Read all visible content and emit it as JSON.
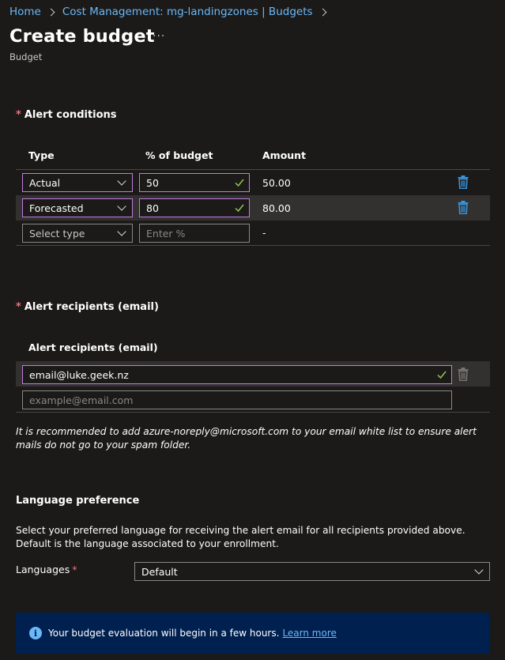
{
  "breadcrumb": {
    "items": [
      "Home",
      "Cost Management: mg-landingzones | Budgets"
    ]
  },
  "header": {
    "title": "Create budget",
    "more": "···",
    "subtitle": "Budget"
  },
  "alert_conditions": {
    "heading": "Alert conditions",
    "required_marker": "*",
    "columns": [
      "Type",
      "% of budget",
      "Amount"
    ],
    "rows": [
      {
        "type": "Actual",
        "percent": "50",
        "amount": "50.00"
      },
      {
        "type": "Forecasted",
        "percent": "80",
        "amount": "80.00"
      }
    ],
    "new_row": {
      "type_placeholder": "Select type",
      "percent_placeholder": "Enter %",
      "amount": "-"
    }
  },
  "alert_recipients": {
    "heading": "Alert recipients (email)",
    "required_marker": "*",
    "column": "Alert recipients (email)",
    "emails": [
      "email@luke.geek.nz"
    ],
    "email_placeholder": "example@email.com"
  },
  "note": "It is recommended to add azure-noreply@microsoft.com to your email white list to ensure alert mails do not go to your spam folder.",
  "language": {
    "heading": "Language preference",
    "description": "Select your preferred language for receiving the alert email for all recipients provided above. Default is the language associated to your enrollment.",
    "label": "Languages",
    "required_marker": "*",
    "selected": "Default"
  },
  "info": {
    "icon": "info-icon",
    "text": "Your budget evaluation will begin in a few hours.",
    "link": "Learn more"
  },
  "colors": {
    "background": "#1b1a19",
    "accent_link": "#6cb8f6",
    "focus_border": "#c27be0",
    "required": "#f1707b",
    "check": "#92c353",
    "info_bar": "#002050"
  }
}
